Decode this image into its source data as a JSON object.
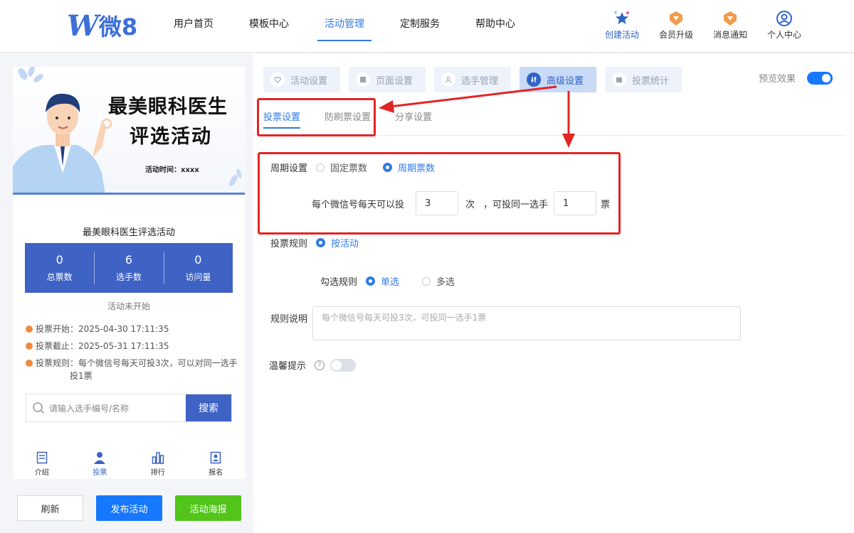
{
  "brand": {
    "logo_letter": "W",
    "logo_text": "微8"
  },
  "nav": [
    {
      "label": "用户首页",
      "active": false
    },
    {
      "label": "模板中心",
      "active": false
    },
    {
      "label": "活动管理",
      "active": true
    },
    {
      "label": "定制服务",
      "active": false
    },
    {
      "label": "帮助中心",
      "active": false
    }
  ],
  "tools": {
    "create": "创建活动",
    "upgrade": "会员升级",
    "notify": "消息通知",
    "profile": "个人中心"
  },
  "preview": {
    "banner_line1": "最美眼科医生",
    "banner_line2": "评选活动",
    "banner_time": "活动时间：xxxx",
    "card_title": "最美眼科医生评选活动",
    "stats": [
      {
        "num": "0",
        "label": "总票数"
      },
      {
        "num": "6",
        "label": "选手数"
      },
      {
        "num": "0",
        "label": "访问量"
      }
    ],
    "status": "活动未开始",
    "vote_start": "投票开始：2025-04-30 17:11:35",
    "vote_end": "投票截止：2025-05-31 17:11:35",
    "vote_rule_1": "投票规则：每个微信号每天可投3次，可以对同一选手",
    "vote_rule_2": "投1票",
    "search_placeholder": "请输入选手编号/名称",
    "search_button": "搜索",
    "tabbar": [
      {
        "label": "介绍",
        "active": false
      },
      {
        "label": "投票",
        "active": true
      },
      {
        "label": "排行",
        "active": false
      },
      {
        "label": "报名",
        "active": false
      }
    ]
  },
  "actions": {
    "refresh": "刷新",
    "publish": "发布活动",
    "poster": "活动海报"
  },
  "steps": [
    {
      "label": "活动设置",
      "active": false
    },
    {
      "label": "页面设置",
      "active": false
    },
    {
      "label": "选手管理",
      "active": false
    },
    {
      "label": "高级设置",
      "active": true
    },
    {
      "label": "投票统计",
      "active": false
    }
  ],
  "preview_toggle": {
    "label": "预览效果",
    "on": true
  },
  "subtabs": [
    {
      "label": "投票设置",
      "active": true
    },
    {
      "label": "防刷票设置",
      "active": false
    },
    {
      "label": "分享设置",
      "active": false
    }
  ],
  "form": {
    "cycle_label": "周期设置",
    "cycle_fixed": "固定票数",
    "cycle_period": "周期票数",
    "per_day_text": "每个微信号每天可以投",
    "per_day_value": "3",
    "unit_times": "次",
    "same_text": "，可投同一选手",
    "same_value": "1",
    "unit_votes": "票",
    "rule_label": "投票规则",
    "rule_by_activity": "按活动",
    "select_label": "勾选规则",
    "select_single": "单选",
    "select_multi": "多选",
    "desc_label": "规则说明",
    "desc_placeholder": "每个微信号每天可投3次，可投同一选手1票",
    "tip_label": "温馨提示",
    "tip_help": "?",
    "tip_on": false
  }
}
